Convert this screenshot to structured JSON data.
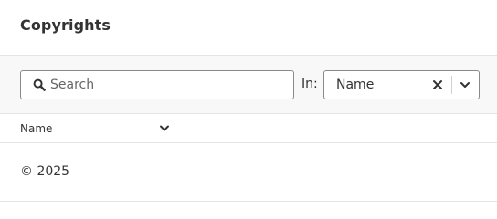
{
  "header": {
    "title": "Copyrights"
  },
  "toolbar": {
    "search_placeholder": "Search",
    "search_value": "",
    "in_label": "In:",
    "field_select": {
      "selected": "Name"
    }
  },
  "table": {
    "columns": [
      {
        "label": "Name"
      }
    ],
    "rows": [
      {
        "name": "© 2025"
      }
    ]
  },
  "icons": {
    "search": "search-icon",
    "clear": "close-icon",
    "dropdown": "chevron-down-icon",
    "sort": "chevron-down-icon"
  }
}
